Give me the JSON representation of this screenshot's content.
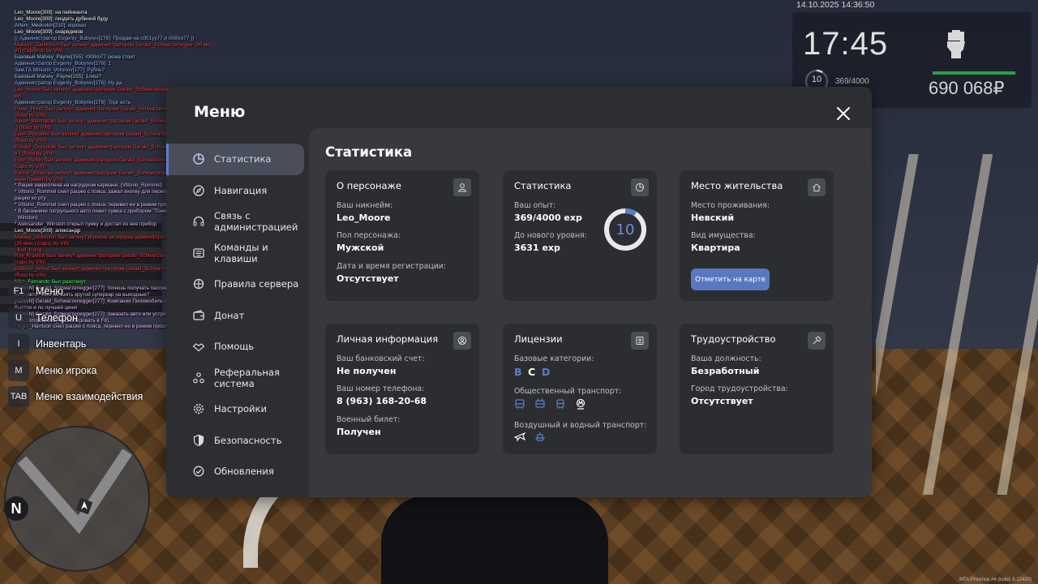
{
  "chat": [
    {
      "text": "Leo_Moore[309]: на пейнканта",
      "color": "#ffffff"
    },
    {
      "text": "Leo_Moore[309]: пиздить дубиной буду",
      "color": "#ffffff"
    },
    {
      "text": "Artem_Medovkin[210]: хорошо",
      "color": "#9ec9ff"
    },
    {
      "text": "Leo_Moore[309]: снарядиков",
      "color": "#ffffff"
    },
    {
      "text": "(( Администратор Evgeniy_Bobyrev[276]: Продам на c001yy77 и r000ro77 ))",
      "color": "#8fb7ff"
    },
    {
      "text": "Maksim_Danilovich был заткнут администратором Gerald_Schwarzenegger (30 мин",
      "color": "#ff3b3b"
    },
    {
      "text": "ут) (Оффтоп by VIN)",
      "color": "#ff3b3b"
    },
    {
      "text": "Базовый Matvey_Payne[155]: r000ro77 скока стоит",
      "color": "#8fd0ff"
    },
    {
      "text": "Администратор Evgeniy_Bobyrev[276]: 1",
      "color": "#8fb7ff"
    },
    {
      "text": "Зам.ГА Mitsumi_Voronov[177]: Рубль?",
      "color": "#8fb7ff"
    },
    {
      "text": "Базовый Matvey_Payne[155]: 1ляш?",
      "color": "#8fd0ff"
    },
    {
      "text": "Администратор Evgeniy_Bobyrev[276]: Ну да",
      "color": "#8fb7ff"
    },
    {
      "text": "Leo_Moore был заткнут администратором Gerald_Schwarzenegger (2 час.) (Мут",
      "color": "#ff3b3b"
    },
    {
      "text": "ки)",
      "color": "#ff3b3b"
    },
    {
      "text": "Администратор Evgeniy_Bobyrev[276]: Торг есть",
      "color": "#8fb7ff"
    },
    {
      "text": "Pavel_Hontz был заткнут администратором Gerald_Schwarzenegger (30 мин.)",
      "color": "#ff3b3b"
    },
    {
      "text": "(flood by VIN)",
      "color": "#ff3b3b"
    },
    {
      "text": "Aaron_Manhattan был заткнут администратором Gerald_Schwarzenegger (30 мин",
      "color": "#ff3b3b"
    },
    {
      "text": ".) (flood by VIN)",
      "color": "#ff3b3b"
    },
    {
      "text": "Liam_Pryrodko был заткнут администратором Gerald_Schwarzenegger (2 час.)",
      "color": "#ff3b3b"
    },
    {
      "text": "(flood by VIN)",
      "color": "#ff3b3b"
    },
    {
      "text": "Eduard_Gorodniki был заткнут администратором Gerald_Schwarzenegger (30 ми",
      "color": "#ff3b3b"
    },
    {
      "text": "н.) (flood by VIN)",
      "color": "#ff3b3b"
    },
    {
      "text": "Egor_Yurkin был заткнут администратором Gerald_Schwarzenegger (30 мин.)",
      "color": "#ff3b3b"
    },
    {
      "text": "(caps by VIN)",
      "color": "#ff3b3b"
    },
    {
      "text": "Karina_Jones не заткнут администратором Gerald_Schwarzenegger (2 час.) (Наруш",
      "color": "#ff3b3b"
    },
    {
      "text": "ение правил by VIN)",
      "color": "#ff3b3b"
    },
    {
      "text": "* Рация закреплена на нагрудном кармане. (Vittorio_Rommel)",
      "color": "#e5b8ff"
    },
    {
      "text": "* Vittorio_Rommel снял рацию с пояса, зажал кнопку для переговоров и поднес",
      "color": "#e5b8ff"
    },
    {
      "text": "рацию ко рту",
      "color": "#e5b8ff"
    },
    {
      "text": "* Vittorio_Rommel снял рацию с пояса, перевел ее в режим прослушивания",
      "color": "#e5b8ff"
    },
    {
      "text": "* В багажнике патрульного авто лежит сумка с прибором \"Тоник\". (Aleksander",
      "color": "#e5b8ff"
    },
    {
      "text": "_Winston)",
      "color": "#e5b8ff"
    },
    {
      "text": "* Aleksander_Winston открыл сумку и достал из нее прибор",
      "color": "#e5b8ff"
    },
    {
      "text": "Leo_Moore[309]: александр",
      "color": "#ffffff"
    },
    {
      "text": "Matvey_Umbrchin был заткнут игроком за порушу администратором Gerald_Schwarzenegger",
      "color": "#ff3b3b"
    },
    {
      "text": "(30 мин.) (caps) by VIN",
      "color": "#ff3b3b"
    },
    {
      "text": ", Bull_Irving",
      "color": "#ff3b3b"
    },
    {
      "text": "Roy_Kravlick был заткнут администратором Gerald_Schwarzenegger (30 мин.)",
      "color": "#ff3b3b"
    },
    {
      "text": "(caps by VIN)",
      "color": "#ff3b3b"
    },
    {
      "text": "Addison_Wood был заткнут администратором Gerald_Schwarzenegger (30 мин.)",
      "color": "#ff3b3b"
    },
    {
      "text": "(flood by VIN)",
      "color": "#ff3b3b"
    },
    {
      "text": "Niko_Fernando был разоткнут.",
      "color": "#3dff5a"
    },
    {
      "text": "[ADMIN] Gerald_Schwarzenegger[277]: Хочешь получать пассивный доход со св",
      "color": "#e5b8ff"
    },
    {
      "text": "оего авто? Или же взять крутой суперкар на выходные?",
      "color": "#e5b8ff"
    },
    {
      "text": "[ADMIN] Gerald_Schwarzenegger[277]: Компания Пилимобиль сделает это ваше",
      "color": "#e5b8ff"
    },
    {
      "text": "быстро и по лучшей цене!",
      "color": "#e5b8ff"
    },
    {
      "text": "[ADMIN] Gerald_Schwarzenegger[277]: Заказать авто или устроиться к нам - https",
      "color": "#e5b8ff"
    },
    {
      "text": "://vk.com/pilimobil_4 (Скопировать в F8).",
      "color": "#e5b8ff"
    },
    {
      "text": "* Egor_Harrison снял рацию с пояса, перевел ее в режим прослушивания",
      "color": "#e5b8ff"
    }
  ],
  "hotkeys": [
    {
      "key": "F1",
      "label": "Меню"
    },
    {
      "key": "U",
      "label": "Телефон"
    },
    {
      "key": "I",
      "label": "Инвентарь"
    },
    {
      "key": "M",
      "label": "Меню игрока"
    },
    {
      "key": "TAB",
      "label": "Меню взаимодействия"
    }
  ],
  "radar": {
    "north": "N"
  },
  "hud": {
    "date": "14.10.2025 14:36:50",
    "time": "17:45",
    "level": "10",
    "exp": "369/4000",
    "money": "690 068₽",
    "health_fraction": 1.0
  },
  "watermark": "MTA:Province #4 (build: 6.12420)",
  "menu": {
    "title": "Меню",
    "nav": [
      {
        "label": "Статистика",
        "icon": "pie-chart-icon",
        "active": true
      },
      {
        "label": "Навигация",
        "icon": "compass-icon"
      },
      {
        "label": "Связь с администрацией",
        "icon": "headset-icon"
      },
      {
        "label": "Команды и клавиши",
        "icon": "keyboard-icon"
      },
      {
        "label": "Правила сервера",
        "icon": "rules-icon"
      },
      {
        "label": "Донат",
        "icon": "wallet-icon"
      },
      {
        "label": "Помощь",
        "icon": "handshake-icon"
      },
      {
        "label": "Реферальная система",
        "icon": "referral-icon"
      },
      {
        "label": "Настройки",
        "icon": "gear-icon"
      },
      {
        "label": "Безопасность",
        "icon": "shield-icon"
      },
      {
        "label": "Обновления",
        "icon": "update-icon"
      }
    ],
    "content": {
      "title": "Статистика",
      "character": {
        "title": "О персонаже",
        "nickname_label": "Ваш никнейм:",
        "nickname": "Leo_Moore",
        "gender_label": "Пол персонажа:",
        "gender": "Мужской",
        "reg_label": "Дата и время регистрации:",
        "reg": "Отсутствует"
      },
      "stats": {
        "title": "Статистика",
        "exp_label": "Ваш опыт:",
        "exp": "369/4000 exp",
        "next_label": "До нового уровня:",
        "next": "3631 exp",
        "level": "10",
        "level_progress": 0.092
      },
      "residence": {
        "title": "Место жительства",
        "place_label": "Место проживания:",
        "place": "Невский",
        "property_label": "Вид имущества:",
        "property": "Квартира",
        "map_button": "Отметить на карте"
      },
      "personal": {
        "title": "Личная информация",
        "bank_label": "Ваш банковский счет:",
        "bank": "Не получен",
        "phone_label": "Ваш номер телефона:",
        "phone": "8 (963) 168-20-68",
        "military_label": "Военный билет:",
        "military": "Получен"
      },
      "licenses": {
        "title": "Лицензии",
        "base_label": "Базовые категории:",
        "categories": [
          {
            "letter": "B",
            "color": "#5b7ec8"
          },
          {
            "letter": "C",
            "color": "#ffffff"
          },
          {
            "letter": "D",
            "color": "#5b7ec8"
          }
        ],
        "public_label": "Общественный транспорт:",
        "air_label": "Воздушный и водный транспорт:"
      },
      "employment": {
        "title": "Трудоустройство",
        "position_label": "Ваша должность:",
        "position": "Безработный",
        "city_label": "Город трудоустройства:",
        "city": "Отсутствует"
      }
    }
  },
  "colors": {
    "accent": "#5b7ec8",
    "card": "#2c2d30",
    "panel": "#38393c",
    "menu": "#2d2e31"
  }
}
